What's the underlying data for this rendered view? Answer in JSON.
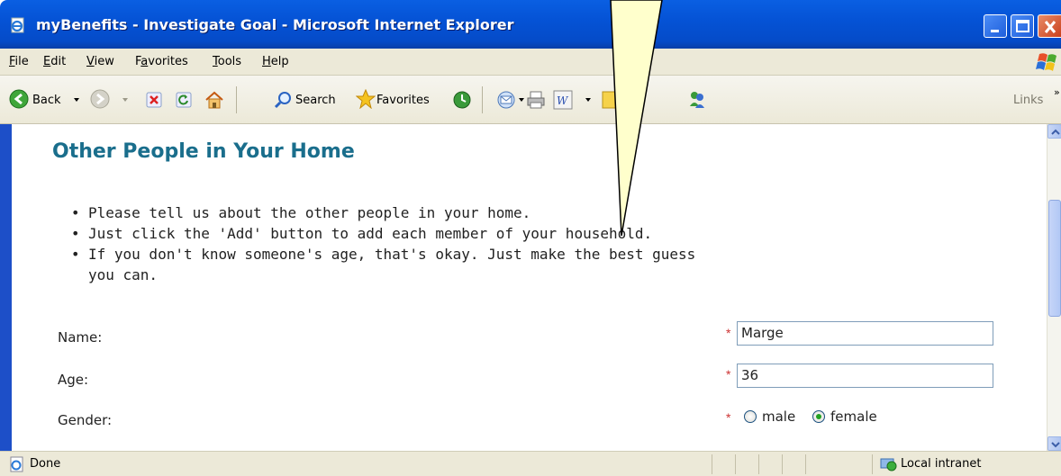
{
  "window": {
    "title": "myBenefits - Investigate Goal - Microsoft Internet Explorer"
  },
  "menu": {
    "items": [
      {
        "label": "File",
        "key": "F",
        "rest": "ile"
      },
      {
        "label": "Edit",
        "key": "E",
        "rest": "dit"
      },
      {
        "label": "View",
        "key": "V",
        "rest": "iew"
      },
      {
        "label": "Favorites",
        "key": "a",
        "pre": "F",
        "rest": "vorites"
      },
      {
        "label": "Tools",
        "key": "T",
        "rest": "ools"
      },
      {
        "label": "Help",
        "key": "H",
        "rest": "elp"
      }
    ]
  },
  "toolbar": {
    "back_label": "Back",
    "search_label": "Search",
    "favorites_label": "Favorites",
    "links_label": "Links",
    "chevron": "»"
  },
  "page": {
    "heading": "Other People in Your Home",
    "instructions": [
      "Please tell us about the other people in your home.",
      "Just click the 'Add' button to add each member of your household.",
      "If you don't know someone's age, that's okay. Just make the best guess you can."
    ],
    "form": {
      "name_label": "Name:",
      "name_value": "Marge",
      "age_label": "Age:",
      "age_value": "36",
      "gender_label": "Gender:",
      "required_marker": "*",
      "gender_options": [
        "male",
        "female"
      ],
      "gender_selected": "female"
    }
  },
  "status": {
    "text": "Done",
    "zone": "Local intranet"
  },
  "colors": {
    "heading": "#1a6e8c",
    "required": "#cc3333",
    "titlebar": "#0553d6",
    "chrome": "#ece9d8"
  }
}
